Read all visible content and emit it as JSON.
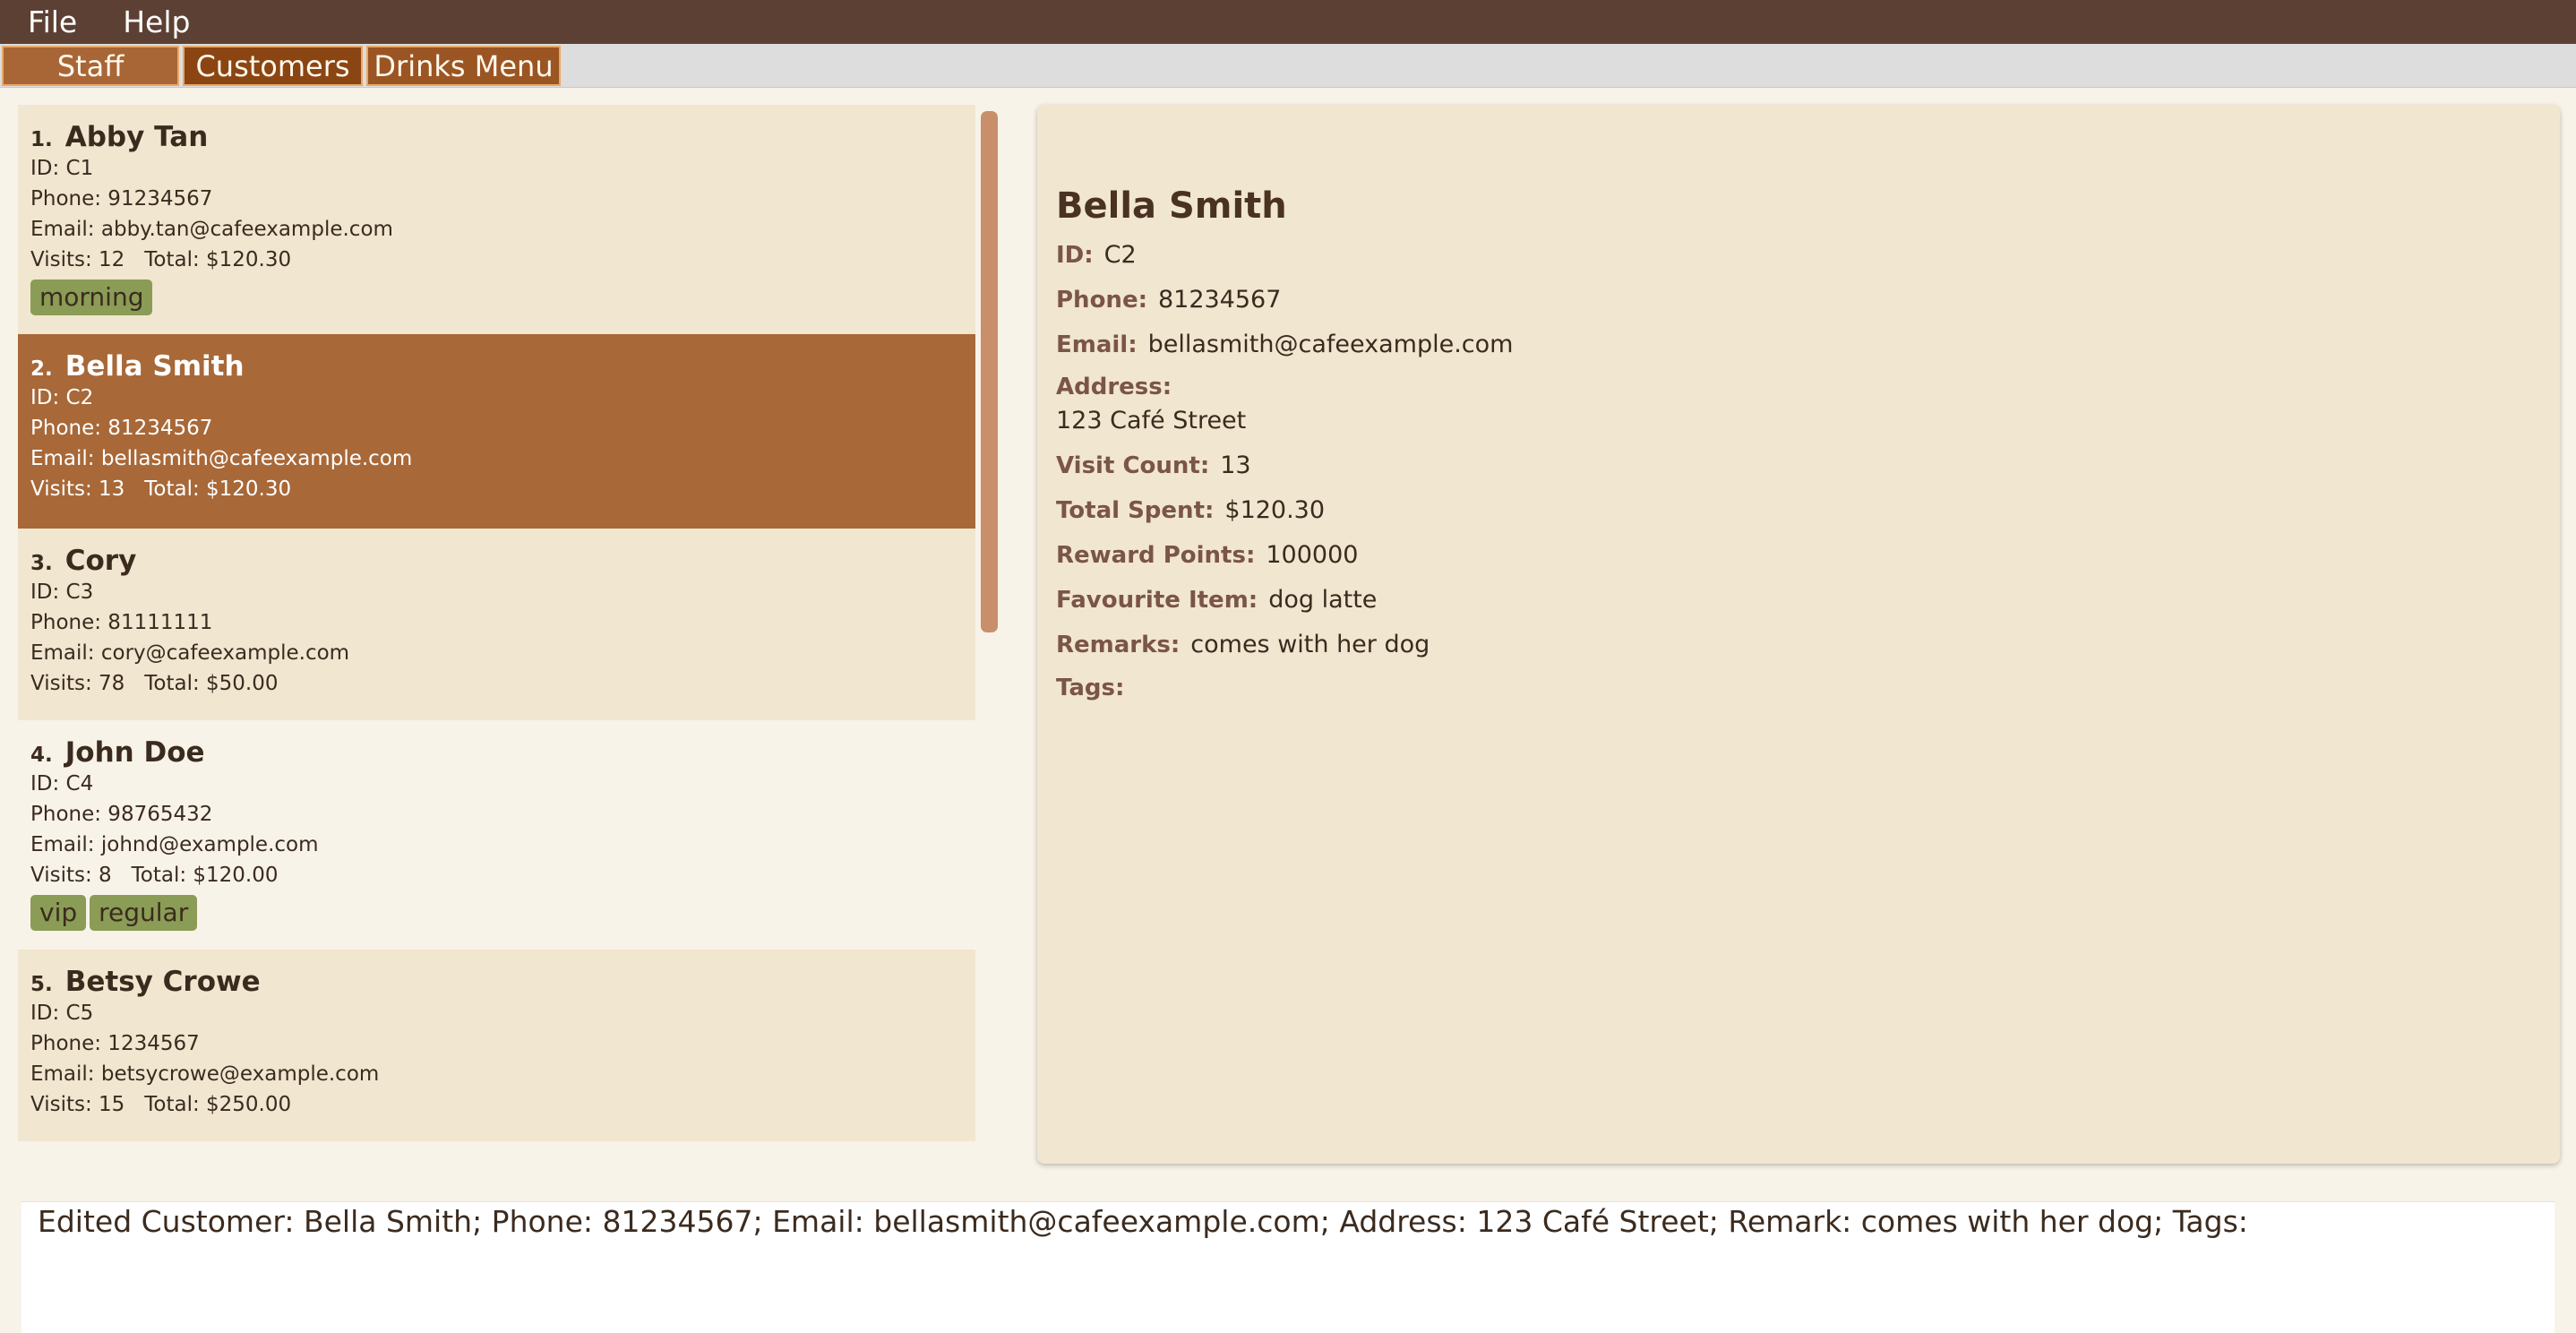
{
  "menu": {
    "file": "File",
    "help": "Help"
  },
  "tabs": {
    "staff": "Staff",
    "customers": "Customers",
    "drinks": "Drinks Menu"
  },
  "customers": [
    {
      "index": "1.",
      "name": "Abby Tan",
      "id": "ID: C1",
      "phone": "Phone: 91234567",
      "email": "Email: abby.tan@cafeexample.com",
      "stats": "Visits: 12   Total: $120.30",
      "tags": [
        "morning"
      ]
    },
    {
      "index": "2.",
      "name": "Bella Smith",
      "id": "ID: C2",
      "phone": "Phone: 81234567",
      "email": "Email: bellasmith@cafeexample.com",
      "stats": "Visits: 13   Total: $120.30",
      "tags": []
    },
    {
      "index": "3.",
      "name": "Cory",
      "id": "ID: C3",
      "phone": "Phone: 81111111",
      "email": "Email: cory@cafeexample.com",
      "stats": "Visits: 78   Total: $50.00",
      "tags": []
    },
    {
      "index": "4.",
      "name": "John Doe",
      "id": "ID: C4",
      "phone": "Phone: 98765432",
      "email": "Email: johnd@example.com",
      "stats": "Visits: 8   Total: $120.00",
      "tags": [
        "vip",
        "regular"
      ]
    },
    {
      "index": "5.",
      "name": "Betsy Crowe",
      "id": "ID: C5",
      "phone": "Phone: 1234567",
      "email": "Email: betsycrowe@example.com",
      "stats": "Visits: 15   Total: $250.00",
      "tags": []
    }
  ],
  "selected_index": 2,
  "detail": {
    "name": "Bella Smith",
    "id_label": "ID:",
    "id": "C2",
    "phone_label": "Phone:",
    "phone": "81234567",
    "email_label": "Email:",
    "email": "bellasmith@cafeexample.com",
    "address_label": "Address:",
    "address": "123 Café Street",
    "visit_count_label": "Visit Count:",
    "visit_count": "13",
    "total_spent_label": "Total Spent:",
    "total_spent": "$120.30",
    "reward_points_label": "Reward Points:",
    "reward_points": "100000",
    "favourite_item_label": "Favourite Item:",
    "favourite_item": "dog latte",
    "remarks_label": "Remarks:",
    "remarks": "comes with her dog",
    "tags_label": "Tags:"
  },
  "result": "Edited Customer: Bella Smith; Phone: 81234567; Email: bellasmith@cafeexample.com; Address: 123 Café Street; Remark: comes with her dog; Tags:"
}
